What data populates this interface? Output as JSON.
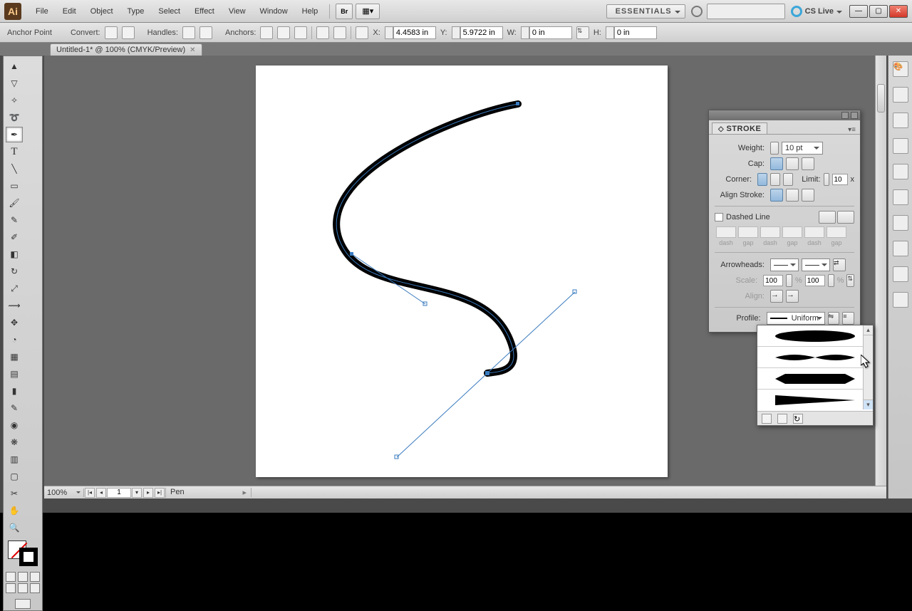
{
  "menubar": {
    "items": [
      "File",
      "Edit",
      "Object",
      "Type",
      "Select",
      "Effect",
      "View",
      "Window",
      "Help"
    ]
  },
  "workspace": "ESSENTIALS",
  "cslive": "CS Live",
  "ctrlbar": {
    "mode": "Anchor Point",
    "convert": "Convert:",
    "handles": "Handles:",
    "anchors": "Anchors:",
    "x_label": "X:",
    "x": "4.4583 in",
    "y_label": "Y:",
    "y": "5.9722 in",
    "w_label": "W:",
    "w": "0 in",
    "h_label": "H:",
    "h": "0 in"
  },
  "tab": "Untitled-1* @ 100% (CMYK/Preview)",
  "stroke": {
    "title": "STROKE",
    "weight_label": "Weight:",
    "weight": "10 pt",
    "cap_label": "Cap:",
    "corner_label": "Corner:",
    "limit_label": "Limit:",
    "limit": "10",
    "limit_suffix": "x",
    "align_label": "Align Stroke:",
    "dashed": "Dashed Line",
    "dash": "dash",
    "gap": "gap",
    "arrow_label": "Arrowheads:",
    "scale_label": "Scale:",
    "scale1": "100",
    "scale2": "100",
    "pct": "%",
    "align2_label": "Align:",
    "profile_label": "Profile:",
    "profile": "Uniform"
  },
  "status": {
    "zoom": "100%",
    "page": "1",
    "tool": "Pen"
  }
}
